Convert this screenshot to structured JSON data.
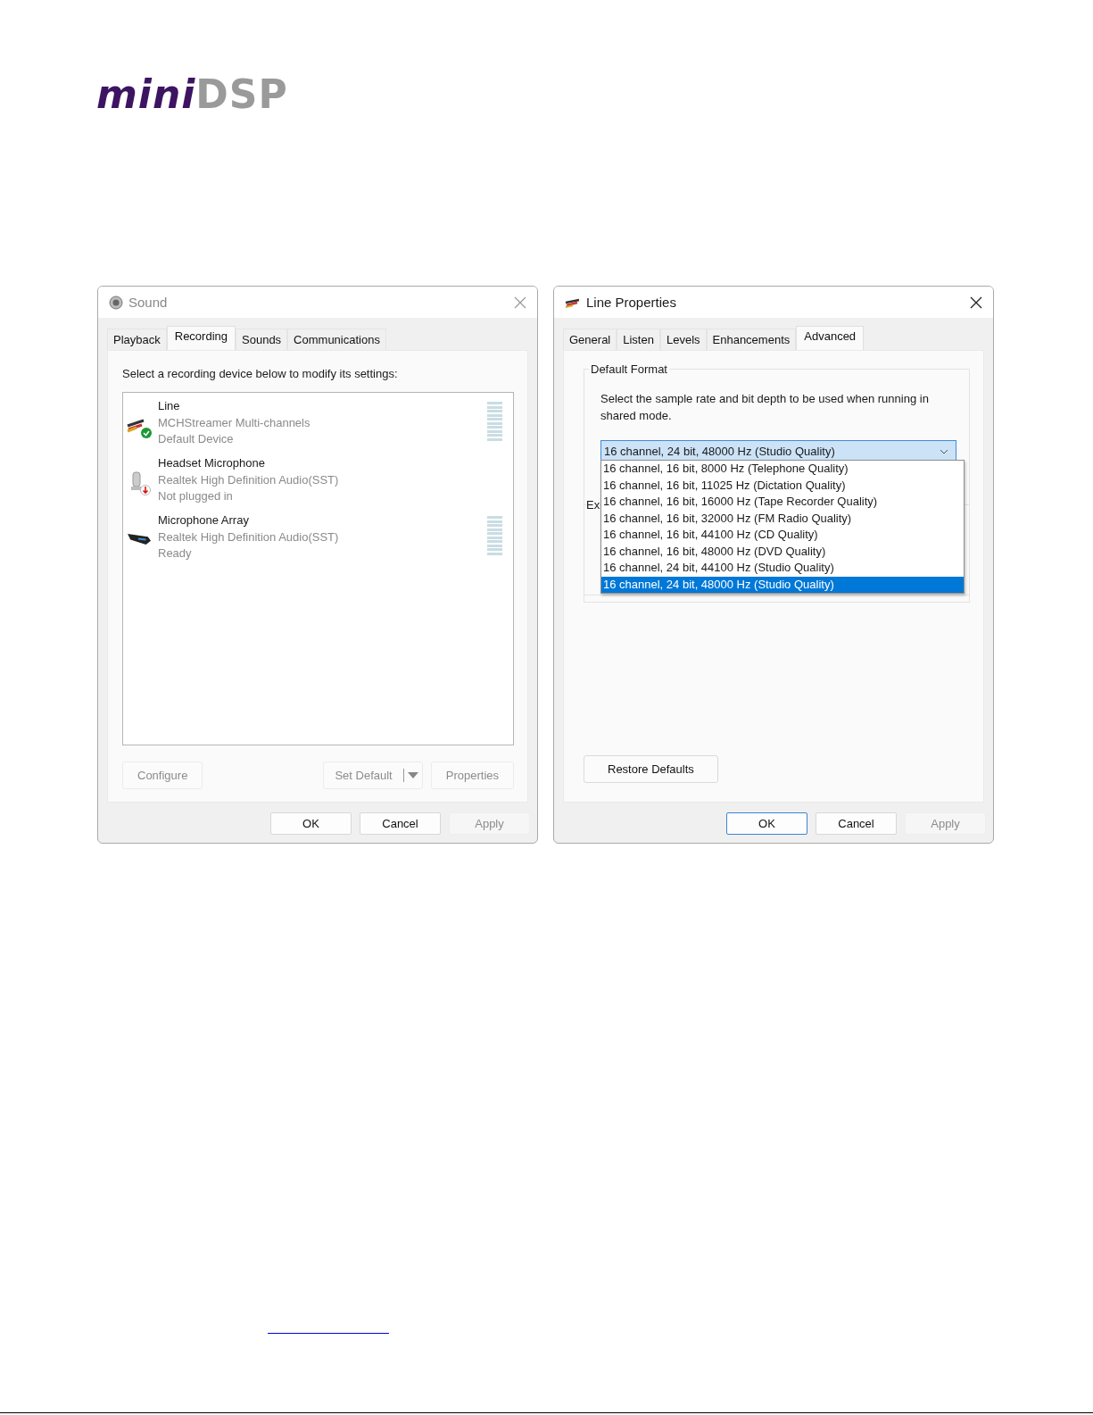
{
  "logo": {
    "mark": "mini",
    "suffix": "DSP"
  },
  "sound_window": {
    "title": "Sound",
    "tabs": [
      {
        "label": "Playback",
        "selected": false
      },
      {
        "label": "Recording",
        "selected": true
      },
      {
        "label": "Sounds",
        "selected": false
      },
      {
        "label": "Communications",
        "selected": false
      }
    ],
    "instruction": "Select a recording device below to modify its settings:",
    "devices": [
      {
        "kind": "line",
        "name": "Line",
        "driver": "MCHStreamer Multi-channels",
        "status": "Default Device",
        "default": true,
        "unplugged": false,
        "meter": true
      },
      {
        "kind": "headset",
        "name": "Headset Microphone",
        "driver": "Realtek High Definition Audio(SST)",
        "status": "Not plugged in",
        "default": false,
        "unplugged": true,
        "meter": false
      },
      {
        "kind": "array",
        "name": "Microphone Array",
        "driver": "Realtek High Definition Audio(SST)",
        "status": "Ready",
        "default": false,
        "unplugged": false,
        "meter": true
      }
    ],
    "device_buttons": [
      {
        "kind": "plain",
        "label": "Configure",
        "disabled": true
      },
      {
        "kind": "split",
        "label": "Set Default",
        "disabled": true
      },
      {
        "kind": "plain",
        "label": "Properties",
        "disabled": true
      }
    ],
    "buttons": [
      {
        "label": "OK",
        "disabled": false,
        "default": false
      },
      {
        "label": "Cancel",
        "disabled": false,
        "default": false
      },
      {
        "label": "Apply",
        "disabled": true,
        "default": false
      }
    ]
  },
  "properties_window": {
    "title": "Line Properties",
    "tabs": [
      {
        "label": "General",
        "selected": false
      },
      {
        "label": "Listen",
        "selected": false
      },
      {
        "label": "Levels",
        "selected": false
      },
      {
        "label": "Enhancements",
        "selected": false
      },
      {
        "label": "Advanced",
        "selected": true
      }
    ],
    "group_title": "Default Format",
    "description": "Select the sample rate and bit depth to be used when running in shared mode.",
    "format_value": "16 channel, 24 bit, 48000 Hz (Studio Quality)",
    "format_options": [
      {
        "label": "16 channel, 16 bit, 8000 Hz (Telephone Quality)",
        "selected": false
      },
      {
        "label": "16 channel, 16 bit, 11025 Hz (Dictation Quality)",
        "selected": false
      },
      {
        "label": "16 channel, 16 bit, 16000 Hz (Tape Recorder Quality)",
        "selected": false
      },
      {
        "label": "16 channel, 16 bit, 32000 Hz (FM Radio Quality)",
        "selected": false
      },
      {
        "label": "16 channel, 16 bit, 44100 Hz (CD Quality)",
        "selected": false
      },
      {
        "label": "16 channel, 16 bit, 48000 Hz (DVD Quality)",
        "selected": false
      },
      {
        "label": "16 channel, 24 bit, 44100 Hz (Studio Quality)",
        "selected": false
      },
      {
        "label": "16 channel, 24 bit, 48000 Hz (Studio Quality)",
        "selected": true
      }
    ],
    "second_group_title": "Ex",
    "restore_button": "Restore Defaults",
    "buttons": [
      {
        "label": "OK",
        "disabled": false,
        "default": true
      },
      {
        "label": "Cancel",
        "disabled": false,
        "default": false
      },
      {
        "label": "Apply",
        "disabled": true,
        "default": false
      }
    ]
  }
}
